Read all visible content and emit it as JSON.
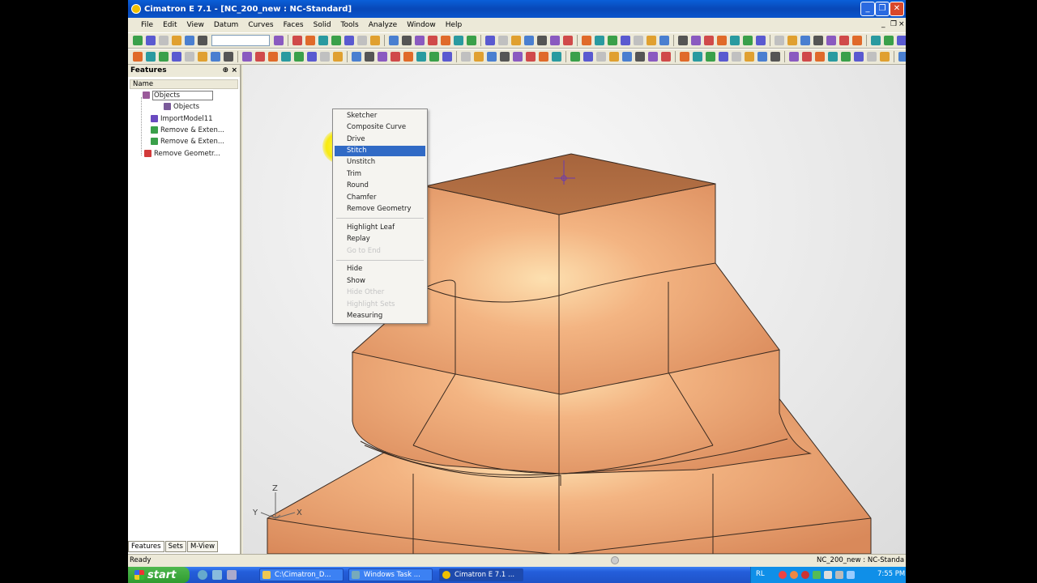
{
  "window": {
    "title": "Cimatron E 7.1 - [NC_200_new : NC-Standard]",
    "icons": [
      "app-icon",
      "minimize-icon",
      "maximize-icon",
      "close-icon"
    ]
  },
  "menubar": {
    "items": [
      "File",
      "Edit",
      "View",
      "Datum",
      "Curves",
      "Faces",
      "Solid",
      "Tools",
      "Analyze",
      "Window",
      "Help"
    ]
  },
  "features_panel": {
    "title": "Features",
    "pin": "⊕",
    "close": "×",
    "column_header": "Name",
    "tree": [
      {
        "label": "Objects",
        "level": 1,
        "icon_color": "#9a5a9a"
      },
      {
        "label": "Objects",
        "level": 2,
        "icon_color": "#7a5a9a"
      },
      {
        "label": "ImportModel11",
        "level": 1,
        "icon_color": "#6a4ac0"
      },
      {
        "label": "Remove & Exten...",
        "level": 1,
        "icon_color": "#3aa04a"
      },
      {
        "label": "Remove & Exten...",
        "level": 1,
        "icon_color": "#3aa04a"
      },
      {
        "label": "Remove Geometr...",
        "level": 1,
        "icon_color": "#d23a3a"
      }
    ],
    "tabs": [
      "Features",
      "Sets",
      "M-View"
    ],
    "active_tab": "Features"
  },
  "context_menu": {
    "items": [
      {
        "label": "Sketcher",
        "state": "normal"
      },
      {
        "label": "Composite Curve",
        "state": "normal"
      },
      {
        "label": "Drive",
        "state": "normal"
      },
      {
        "label": "Stitch",
        "state": "selected"
      },
      {
        "label": "Unstitch",
        "state": "normal"
      },
      {
        "label": "Trim",
        "state": "normal"
      },
      {
        "label": "Round",
        "state": "normal"
      },
      {
        "label": "Chamfer",
        "state": "normal"
      },
      {
        "label": "Remove Geometry",
        "state": "normal"
      },
      {
        "separator": true
      },
      {
        "label": "Highlight Leaf",
        "state": "normal"
      },
      {
        "label": "Replay",
        "state": "normal"
      },
      {
        "label": "Go to End",
        "state": "disabled"
      },
      {
        "separator": true
      },
      {
        "label": "Hide",
        "state": "normal"
      },
      {
        "label": "Show",
        "state": "normal"
      },
      {
        "label": "Hide Other",
        "state": "disabled"
      },
      {
        "label": "Highlight Sets",
        "state": "disabled"
      },
      {
        "label": "Measuring",
        "state": "normal"
      }
    ]
  },
  "viewport": {
    "axis_labels": {
      "z": "Z",
      "y": "Y",
      "x": "X"
    },
    "model_color": "#e8a070"
  },
  "statusbar": {
    "left": "Ready",
    "right": "NC_200_new : NC-Standa"
  },
  "taskbar": {
    "start": "start",
    "tasks": [
      {
        "label": "C:\\Cimatron_D...",
        "icon": "folder-icon"
      },
      {
        "label": "Windows Task ...",
        "icon": "task-manager-icon"
      },
      {
        "label": "Cimatron E 7.1 ...",
        "icon": "cimatron-icon"
      }
    ],
    "tray_lang": "RL",
    "clock": "7:55 PM"
  },
  "colors": {
    "selection": "#316ac5",
    "titlebar": "#0a5fd8",
    "viewport_bg": "#e6e6e6"
  }
}
